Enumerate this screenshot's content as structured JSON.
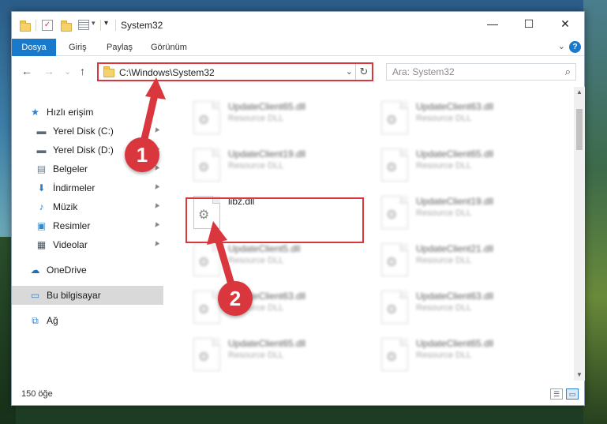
{
  "window": {
    "title": "System32",
    "minimize": "—",
    "maximize": "☐",
    "close": "✕"
  },
  "ribbon": {
    "tabs": [
      {
        "label": "Dosya",
        "active": true
      },
      {
        "label": "Giriş",
        "active": false
      },
      {
        "label": "Paylaş",
        "active": false
      },
      {
        "label": "Görünüm",
        "active": false
      }
    ],
    "expand": "⌄",
    "help": "?"
  },
  "nav": {
    "back": "←",
    "forward": "→",
    "recent": "⌄",
    "up": "↑"
  },
  "address": {
    "path": "C:\\Windows\\System32",
    "dropdown": "⌄",
    "refresh": "↻"
  },
  "search": {
    "placeholder": "Ara: System32",
    "icon": "⌕"
  },
  "sidebar": {
    "items": [
      {
        "label": "Hızlı erişim",
        "icon": "star-icon",
        "glyph": "★",
        "color": "#2f7fd0",
        "pinned": false
      },
      {
        "label": "Yerel Disk (C:)",
        "icon": "drive-c-icon",
        "glyph": "▬",
        "color": "#5a6b7a",
        "pinned": true
      },
      {
        "label": "Yerel Disk (D:)",
        "icon": "drive-d-icon",
        "glyph": "▬",
        "color": "#5a6b7a",
        "pinned": true
      },
      {
        "label": "Belgeler",
        "icon": "documents-icon",
        "glyph": "▤",
        "color": "#6b7a88",
        "pinned": true
      },
      {
        "label": "İndirmeler",
        "icon": "download-icon",
        "glyph": "⬇",
        "color": "#2f7fd0",
        "pinned": true
      },
      {
        "label": "Müzik",
        "icon": "music-icon",
        "glyph": "♪",
        "color": "#2f7fd0",
        "pinned": true
      },
      {
        "label": "Resimler",
        "icon": "pictures-icon",
        "glyph": "▣",
        "color": "#3a8ac4",
        "pinned": true
      },
      {
        "label": "Videolar",
        "icon": "videos-icon",
        "glyph": "▦",
        "color": "#4a5560",
        "pinned": true
      },
      {
        "label": "OneDrive",
        "icon": "cloud-icon",
        "glyph": "☁",
        "color": "#1e6fc0",
        "pinned": false
      },
      {
        "label": "Bu bilgisayar",
        "icon": "computer-icon",
        "glyph": "▭",
        "color": "#3a7fc0",
        "pinned": false,
        "selected": true
      },
      {
        "label": "Ağ",
        "icon": "network-icon",
        "glyph": "⧉",
        "color": "#3a7fc0",
        "pinned": false
      }
    ],
    "pin_glyph": "📌"
  },
  "files": [
    {
      "name": "UpdateClient65.dll",
      "type": "Resource DLL",
      "blurred": true
    },
    {
      "name": "UpdateClient63.dll",
      "type": "Resource DLL",
      "blurred": true
    },
    {
      "name": "UpdateClient19.dll",
      "type": "Resource DLL",
      "blurred": true
    },
    {
      "name": "UpdateClient65.dll",
      "type": "Resource DLL",
      "blurred": true
    },
    {
      "name": "libz.dll",
      "type": "",
      "blurred": false
    },
    {
      "name": "UpdateClient19.dll",
      "type": "Resource DLL",
      "blurred": true
    },
    {
      "name": "UpdateClient5.dll",
      "type": "Resource DLL",
      "blurred": true
    },
    {
      "name": "UpdateClient21.dll",
      "type": "Resource DLL",
      "blurred": true
    },
    {
      "name": "UpdateClient63.dll",
      "type": "Resource DLL",
      "blurred": true
    },
    {
      "name": "UpdateClient63.dll",
      "type": "Resource DLL",
      "blurred": true
    },
    {
      "name": "UpdateClient65.dll",
      "type": "Resource DLL",
      "blurred": true
    },
    {
      "name": "UpdateClient65.dll",
      "type": "Resource DLL",
      "blurred": true
    }
  ],
  "status": {
    "count": "150 öğe"
  },
  "callouts": {
    "step1": "1",
    "step2": "2",
    "highlight_color": "#d9363e"
  }
}
